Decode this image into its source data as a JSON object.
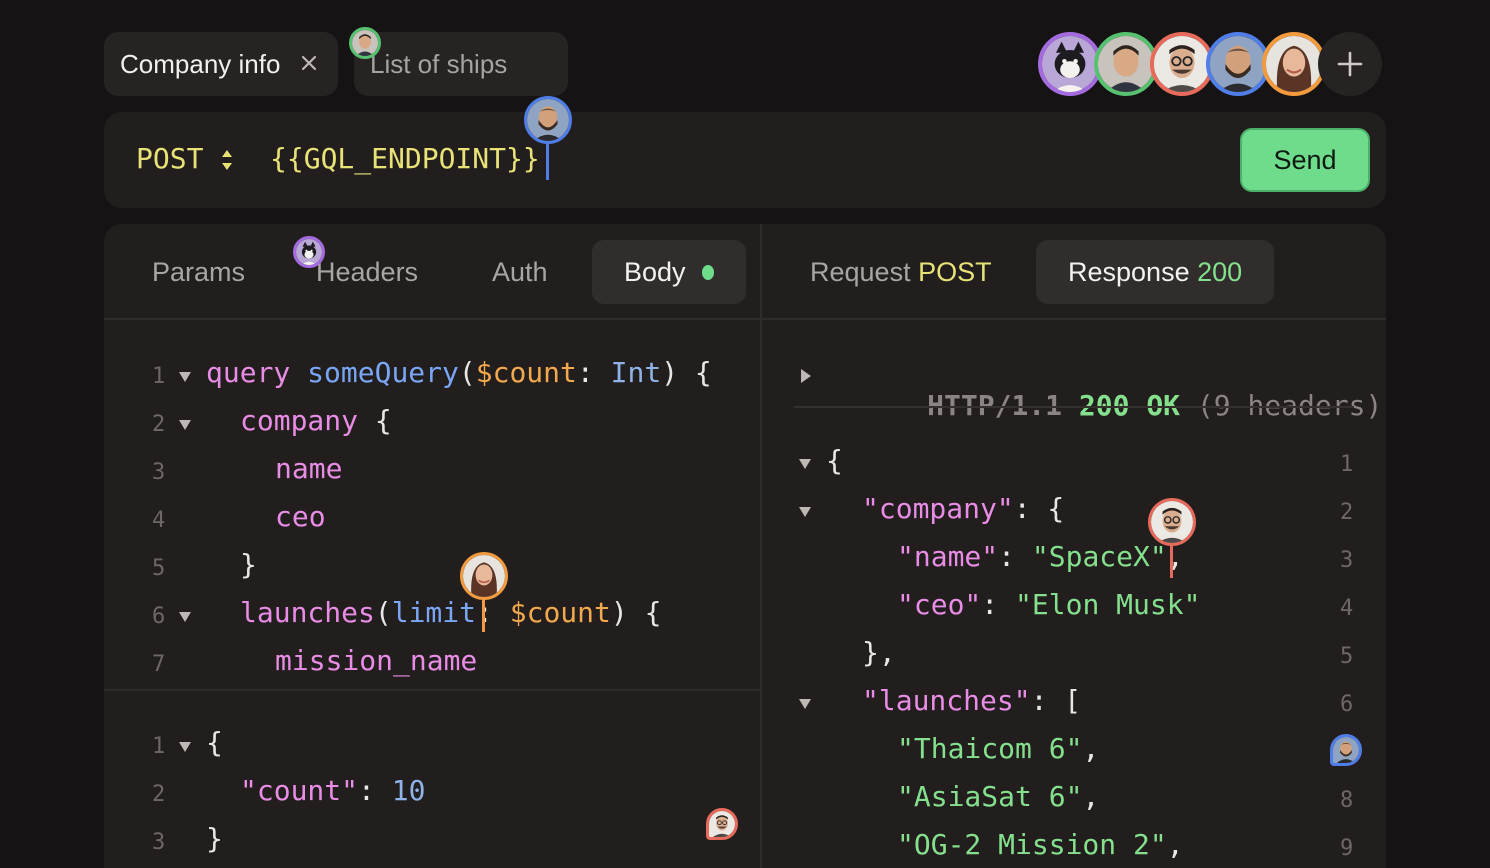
{
  "tabs": [
    {
      "label": "Company info",
      "active": true
    },
    {
      "label": "List of ships",
      "active": false
    }
  ],
  "collaborators": [
    {
      "name": "avatar-1",
      "ring": "#a46be0"
    },
    {
      "name": "avatar-2",
      "ring": "#56c26f"
    },
    {
      "name": "avatar-3",
      "ring": "#e86a5a"
    },
    {
      "name": "avatar-4",
      "ring": "#4f7ee8"
    },
    {
      "name": "avatar-5",
      "ring": "#f29a3c"
    }
  ],
  "request": {
    "method": "POST",
    "endpoint": "{{GQL_ENDPOINT}}",
    "send_label": "Send"
  },
  "left_tabs": {
    "params": "Params",
    "headers": "Headers",
    "auth": "Auth",
    "body": "Body"
  },
  "right_tabs": {
    "request_label": "Request",
    "request_method": "POST",
    "response_label": "Response",
    "response_code": "200"
  },
  "query_lines": {
    "l1": {
      "kw": "query",
      "fn": "someQuery",
      "open": "(",
      "var": "$count",
      "colon": ": ",
      "type": "Int",
      "close": ") {"
    },
    "l2": {
      "kw": "company",
      "rest": " {"
    },
    "l3": {
      "kw": "name"
    },
    "l4": {
      "kw": "ceo"
    },
    "l5": {
      "rest": "}"
    },
    "l6": {
      "kw": "launches",
      "open": "(",
      "arg": "limit",
      "colon": ": ",
      "var": "$count",
      "close": ") {"
    },
    "l7": {
      "kw": "mission_name"
    }
  },
  "variables_lines": {
    "l1": "{",
    "l2_key": "\"count\"",
    "l2_colon": ": ",
    "l2_val": "10",
    "l3": "}"
  },
  "response": {
    "status_line": {
      "proto": "HTTP/1.1",
      "code": "200",
      "text": "OK",
      "headers": "(9 headers)"
    },
    "lines": {
      "l1": "{",
      "l2_key": "\"company\"",
      "l2_rest": ": {",
      "l3_key": "\"name\"",
      "l3_colon": ": ",
      "l3_val": "\"SpaceX\"",
      "l3_comma": ",",
      "l4_key": "\"ceo\"",
      "l4_colon": ": ",
      "l4_val": "\"Elon Musk\"",
      "l5": "},",
      "l6_key": "\"launches\"",
      "l6_rest": ": [",
      "l7_val": "\"Thaicom 6\"",
      "l7_comma": ",",
      "l8_val": "\"AsiaSat 6\"",
      "l8_comma": ",",
      "l9_val": "\"OG-2 Mission 2\"",
      "l9_comma": ","
    }
  },
  "line_numbers": [
    "1",
    "2",
    "3",
    "4",
    "5",
    "6",
    "7",
    "8",
    "9"
  ]
}
